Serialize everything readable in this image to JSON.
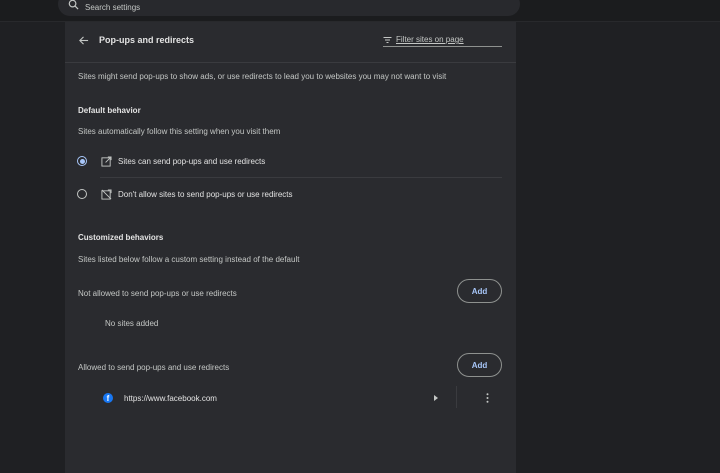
{
  "search": {
    "placeholder": "Search settings"
  },
  "page": {
    "title": "Pop-ups and redirects",
    "filter_placeholder": "Filter sites on page",
    "description": "Sites might send pop-ups to show ads, or use redirects to lead you to websites you may not want to visit"
  },
  "default_behavior": {
    "heading": "Default behavior",
    "subheading": "Sites automatically follow this setting when you visit them",
    "options": [
      {
        "label": "Sites can send pop-ups and use redirects",
        "selected": true,
        "icon": "open-in-new-icon"
      },
      {
        "label": "Don't allow sites to send pop-ups or use redirects",
        "selected": false,
        "icon": "popup-blocked-icon"
      }
    ]
  },
  "customized": {
    "heading": "Customized behaviors",
    "subheading": "Sites listed below follow a custom setting instead of the default",
    "not_allowed": {
      "label": "Not allowed to send pop-ups or use redirects",
      "add_label": "Add",
      "empty_text": "No sites added"
    },
    "allowed": {
      "label": "Allowed to send pop-ups and use redirects",
      "add_label": "Add",
      "sites": [
        {
          "url": "https://www.facebook.com",
          "icon": "facebook-icon"
        }
      ]
    }
  },
  "colors": {
    "accent": "#a8c7fa",
    "panel": "#2a2b2f",
    "background": "#1f2023",
    "facebook": "#1877f2"
  }
}
